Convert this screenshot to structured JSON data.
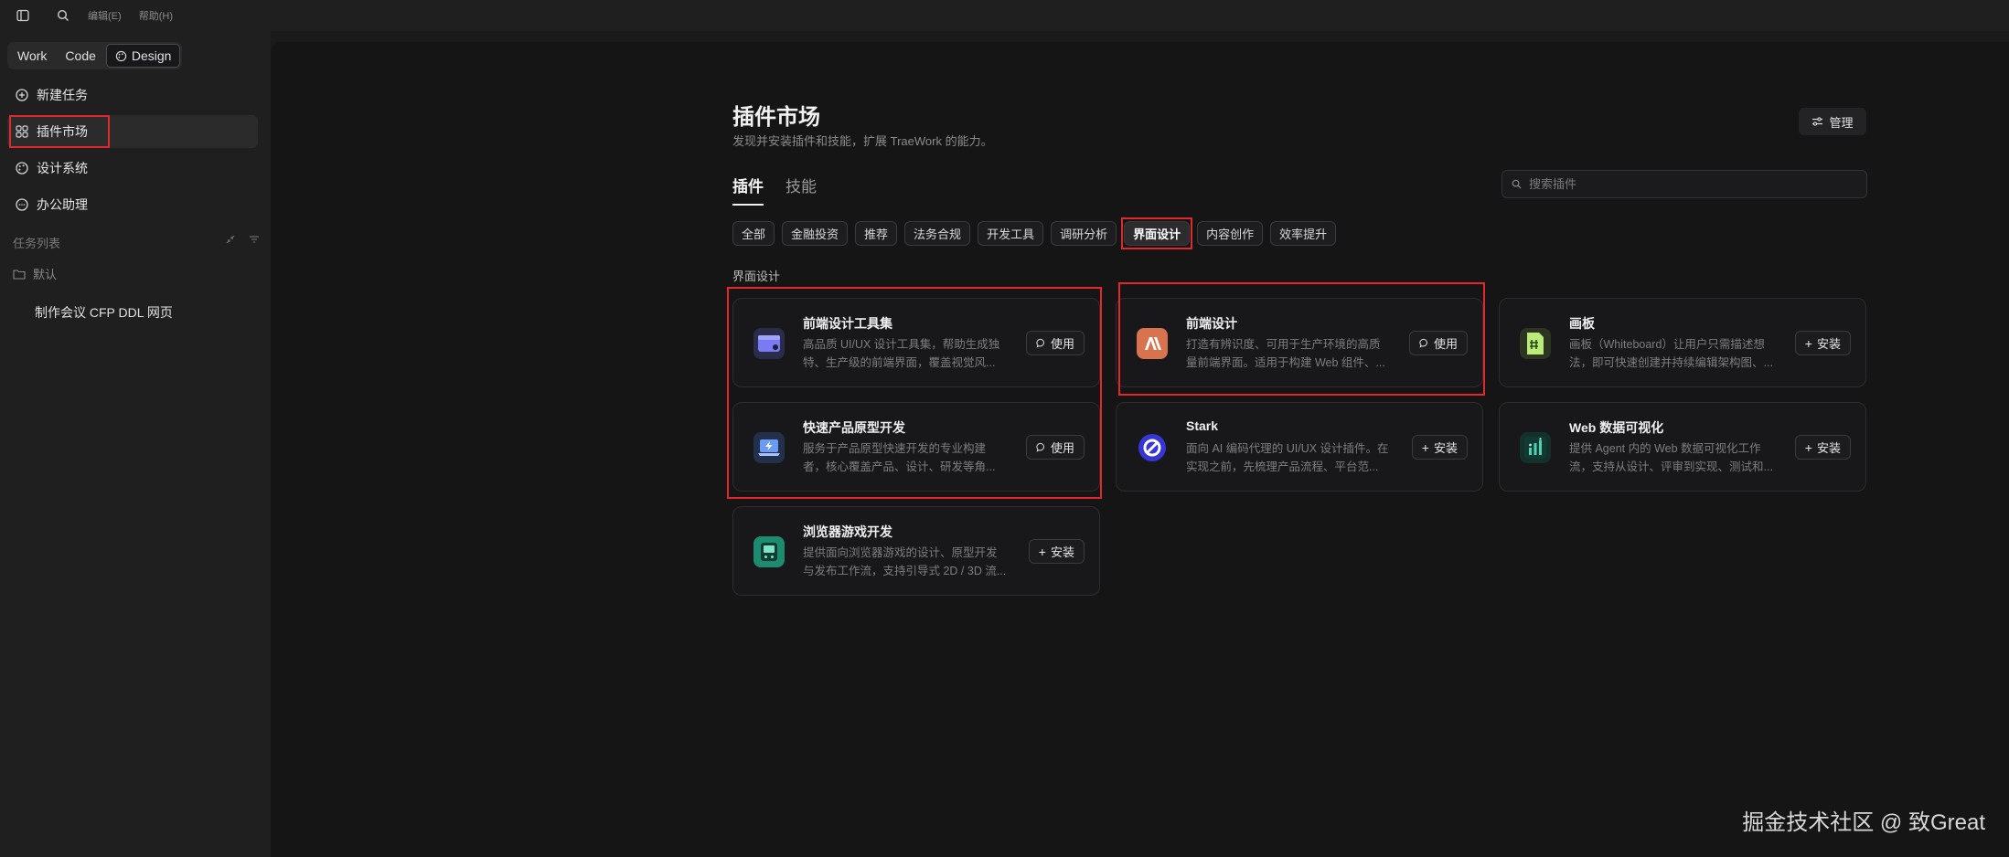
{
  "topbar": {
    "menu": [
      "编辑(E)",
      "帮助(H)"
    ]
  },
  "sidebar": {
    "modes": [
      "Work",
      "Code",
      "Design"
    ],
    "nav": [
      {
        "label": "新建任务",
        "icon": "plus-circle-icon"
      },
      {
        "label": "插件市场",
        "icon": "grid-icon"
      },
      {
        "label": "设计系统",
        "icon": "palette-icon"
      },
      {
        "label": "办公助理",
        "icon": "chat-icon"
      }
    ],
    "task_list_title": "任务列表",
    "folder": "默认",
    "task": "制作会议 CFP DDL 网页"
  },
  "main": {
    "title": "插件市场",
    "subtitle": "发现并安装插件和技能，扩展 TraeWork 的能力。",
    "manage_label": "管理",
    "tabs": [
      "插件",
      "技能"
    ],
    "search_placeholder": "搜索插件",
    "categories": [
      "全部",
      "金融投资",
      "推荐",
      "法务合规",
      "开发工具",
      "调研分析",
      "界面设计",
      "内容创作",
      "效率提升"
    ],
    "active_category": "界面设计",
    "section_label": "界面设计",
    "cards": [
      {
        "name": "前端设计工具集",
        "desc": "高品质 UI/UX 设计工具集，帮助生成独特、生产级的前端界面，覆盖视觉风...",
        "action": "使用",
        "icon_color": "#6f6ff5"
      },
      {
        "name": "前端设计",
        "desc": "打造有辨识度、可用于生产环境的高质量前端界面。适用于构建 Web 组件、...",
        "action": "使用",
        "icon_color": "#d8734f"
      },
      {
        "name": "画板",
        "desc": "画板（Whiteboard）让用户只需描述想法，即可快速创建并持续编辑架构图、...",
        "action": "安装",
        "icon_color": "#9ed36a"
      },
      {
        "name": "快速产品原型开发",
        "desc": "服务于产品原型快速开发的专业构建者，核心覆盖产品、设计、研发等角...",
        "action": "使用",
        "icon_color": "#4f7fe8"
      },
      {
        "name": "Stark",
        "desc": "面向 AI 编码代理的 UI/UX 设计插件。在实现之前，先梳理产品流程、平台范...",
        "action": "安装",
        "icon_color": "#3b3bd6"
      },
      {
        "name": "Web 数据可视化",
        "desc": "提供 Agent 内的 Web 数据可视化工作流，支持从设计、评审到实现、测试和...",
        "action": "安装",
        "icon_color": "#1f7b6b"
      },
      {
        "name": "浏览器游戏开发",
        "desc": "提供面向浏览器游戏的设计、原型开发与发布工作流，支持引导式 2D / 3D 流...",
        "action": "安装",
        "icon_color": "#1e8a6f"
      }
    ]
  },
  "watermark": "掘金技术社区 @ 致Great"
}
